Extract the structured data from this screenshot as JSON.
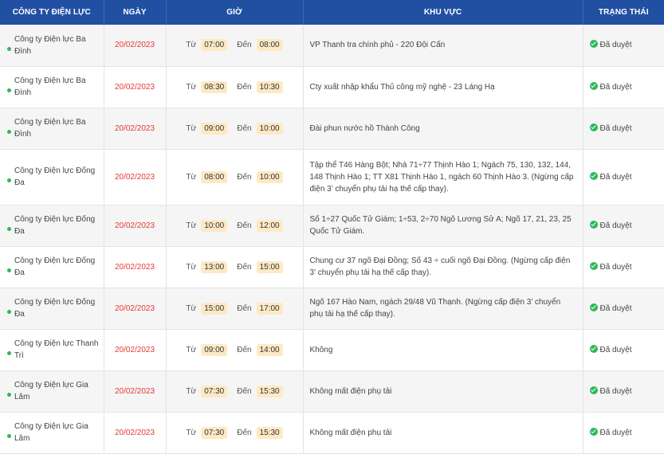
{
  "headers": {
    "company": "CÔNG TY ĐIỆN LỰC",
    "date": "NGÀY",
    "time": "GIỜ",
    "area": "KHU VỰC",
    "status": "TRẠNG THÁI"
  },
  "labels": {
    "from": "Từ",
    "to": "Đến"
  },
  "colors": {
    "header_bg": "#2150a3",
    "date_red": "#e53935",
    "status_green": "#2eb85c",
    "time_pill": "#fde9c4"
  },
  "rows": [
    {
      "company": "Công ty Điện lực Ba Đình",
      "date": "20/02/2023",
      "from": "07:00",
      "to": "08:00",
      "area": "VP Thanh tra chính phủ - 220 Đội Cấn",
      "status": "Đã duyệt"
    },
    {
      "company": "Công ty Điện lực Ba Đình",
      "date": "20/02/2023",
      "from": "08:30",
      "to": "10:30",
      "area": "Cty xuất nhập khẩu Thủ công mỹ nghệ - 23 Láng Hạ",
      "status": "Đã duyệt"
    },
    {
      "company": "Công ty Điện lực Ba Đình",
      "date": "20/02/2023",
      "from": "09:00",
      "to": "10:00",
      "area": "Đài phun nước hồ Thành Công",
      "status": "Đã duyệt"
    },
    {
      "company": "Công ty Điện lực Đống Đa",
      "date": "20/02/2023",
      "from": "08:00",
      "to": "10:00",
      "area": "Tập thể T46 Hàng Bột; Nhà 71÷77 Thịnh Hào 1; Ngách 75, 130, 132, 144, 148 Thịnh Hào 1; TT X81 Thịnh Hào 1, ngách 60 Thịnh Hào 3. (Ngừng cấp điện 3’ chuyển phụ tải hạ thế cấp thay).",
      "status": "Đã duyệt"
    },
    {
      "company": "Công ty Điện lực Đống Đa",
      "date": "20/02/2023",
      "from": "10:00",
      "to": "12:00",
      "area": "Số 1÷27 Quốc Tử Giám; 1÷53, 2÷70 Ngõ Lương Sử A; Ngõ 17, 21, 23, 25 Quốc Tử Giám.",
      "status": "Đã duyệt"
    },
    {
      "company": "Công ty Điện lực Đống Đa",
      "date": "20/02/2023",
      "from": "13:00",
      "to": "15:00",
      "area": "Chung cư 37 ngõ Đại Đồng; Số 43 ÷ cuối ngõ Đại Đồng. (Ngừng cấp điện 3’ chuyển phụ tải hạ thế cấp thay).",
      "status": "Đã duyệt"
    },
    {
      "company": "Công ty Điện lực Đống Đa",
      "date": "20/02/2023",
      "from": "15:00",
      "to": "17:00",
      "area": "Ngõ 167 Hào Nam, ngách 29/48 Vũ Thạnh. (Ngừng cấp điện 3’ chuyển phụ tải hạ thế cấp thay).",
      "status": "Đã duyệt"
    },
    {
      "company": "Công ty Điện lực Thanh Trì",
      "date": "20/02/2023",
      "from": "09:00",
      "to": "14:00",
      "area": "Không",
      "status": "Đã duyệt"
    },
    {
      "company": "Công ty Điện lực Gia Lâm",
      "date": "20/02/2023",
      "from": "07:30",
      "to": "15:30",
      "area": "Không mất điện phụ tải",
      "status": "Đã duyệt"
    },
    {
      "company": "Công ty Điện lực Gia Lâm",
      "date": "20/02/2023",
      "from": "07:30",
      "to": "15:30",
      "area": "Không mất điện phụ tải",
      "status": "Đã duyệt"
    }
  ]
}
